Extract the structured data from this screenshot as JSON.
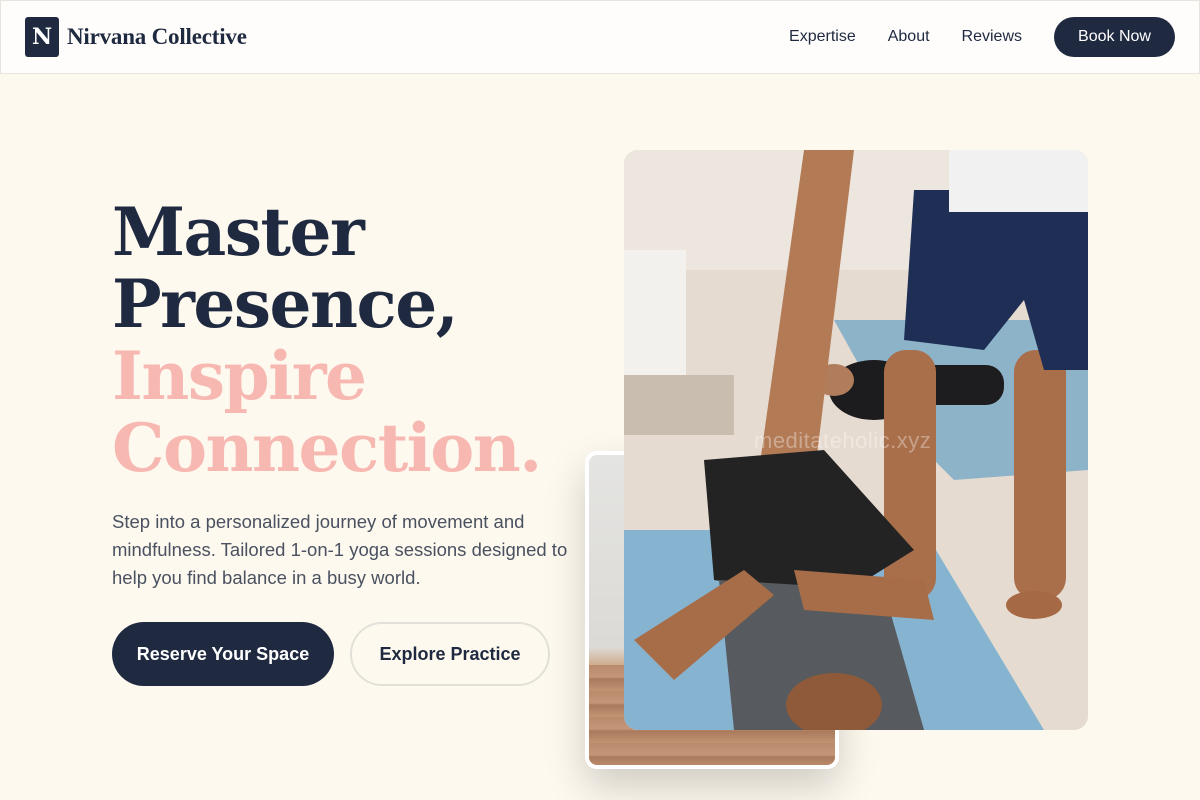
{
  "brand": {
    "mark": "N",
    "name": "Nirvana Collective"
  },
  "nav": {
    "links": [
      "Expertise",
      "About",
      "Reviews"
    ],
    "cta": "Book Now"
  },
  "hero": {
    "title_line1": "Master",
    "title_line2": "Presence,",
    "title_line3": "Inspire",
    "title_line4": "Connection.",
    "subtitle": "Step into a personalized journey of movement and mindfulness. Tailored 1-on-1 yoga sessions designed to help you find balance in a busy world.",
    "primary_cta": "Reserve Your Space",
    "secondary_cta": "Explore Practice"
  },
  "images": {
    "watermark": "meditateholic.xyz"
  },
  "colors": {
    "navy": "#1f2a40",
    "pink": "#f8b8b2",
    "background": "#fdf9ef"
  }
}
